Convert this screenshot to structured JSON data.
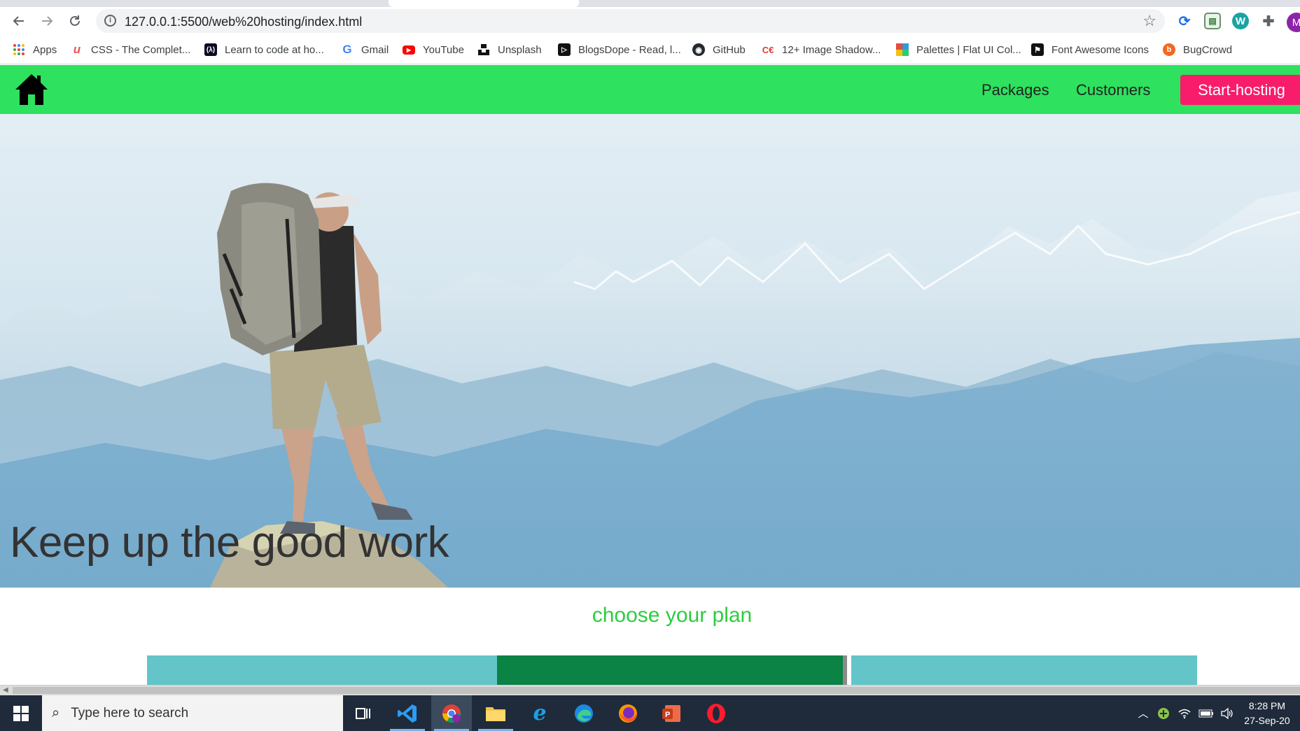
{
  "browser": {
    "url": "127.0.0.1:5500/web%20hosting/index.html",
    "profile_initial": "M",
    "icons": {
      "back": "arrow-left-icon",
      "forward": "arrow-right-icon",
      "reload": "reload-icon",
      "info": "info-icon",
      "bookmark_star": "star-icon",
      "extensions": "puzzle-icon"
    }
  },
  "bookmarks": [
    {
      "label": "Apps",
      "icon": "apps-grid-icon",
      "color": "#4285f4"
    },
    {
      "label": "CSS - The Complet...",
      "icon": "udemy-icon",
      "color": "#ec5252"
    },
    {
      "label": "Learn to code at ho...",
      "icon": "freecodecamp-icon",
      "color": "#0a0a23"
    },
    {
      "label": "Gmail",
      "icon": "google-icon",
      "color": "#4285f4"
    },
    {
      "label": "YouTube",
      "icon": "youtube-icon",
      "color": "#ff0000"
    },
    {
      "label": "Unsplash",
      "icon": "unsplash-icon",
      "color": "#111111"
    },
    {
      "label": "BlogsDope - Read, l...",
      "icon": "blogsdope-icon",
      "color": "#111111"
    },
    {
      "label": "GitHub",
      "icon": "github-icon",
      "color": "#24292e"
    },
    {
      "label": "12+ Image Shadow...",
      "icon": "codingartist-icon",
      "color": "#e53935"
    },
    {
      "label": "Palettes | Flat UI Col...",
      "icon": "palette-icon",
      "color": "#f39c12"
    },
    {
      "label": "Font Awesome Icons",
      "icon": "fontawesome-icon",
      "color": "#111111"
    },
    {
      "label": "BugCrowd",
      "icon": "bugcrowd-icon",
      "color": "#f26822"
    }
  ],
  "site": {
    "nav": {
      "home_icon": "home-icon",
      "links": [
        "Packages",
        "Customers"
      ],
      "cta": "Start-hosting"
    },
    "hero": {
      "title": "Keep up the good work"
    },
    "plans": {
      "heading": "choose your plan",
      "cards": [
        {
          "color": "#63c5c7"
        },
        {
          "color": "#0b8345"
        },
        {
          "color": "#63c5c7"
        }
      ]
    },
    "colors": {
      "navbar": "#2ee15e",
      "cta": "#f81c6a",
      "heading": "#2ecc40"
    }
  },
  "taskbar": {
    "search_placeholder": "Type here to search",
    "apps": [
      "task-view-icon",
      "vscode-icon",
      "chrome-icon",
      "file-explorer-icon",
      "internet-explorer-icon",
      "edge-icon",
      "firefox-icon",
      "powerpoint-icon",
      "opera-icon"
    ],
    "time": "8:28 PM",
    "date": "27-Sep-20"
  }
}
